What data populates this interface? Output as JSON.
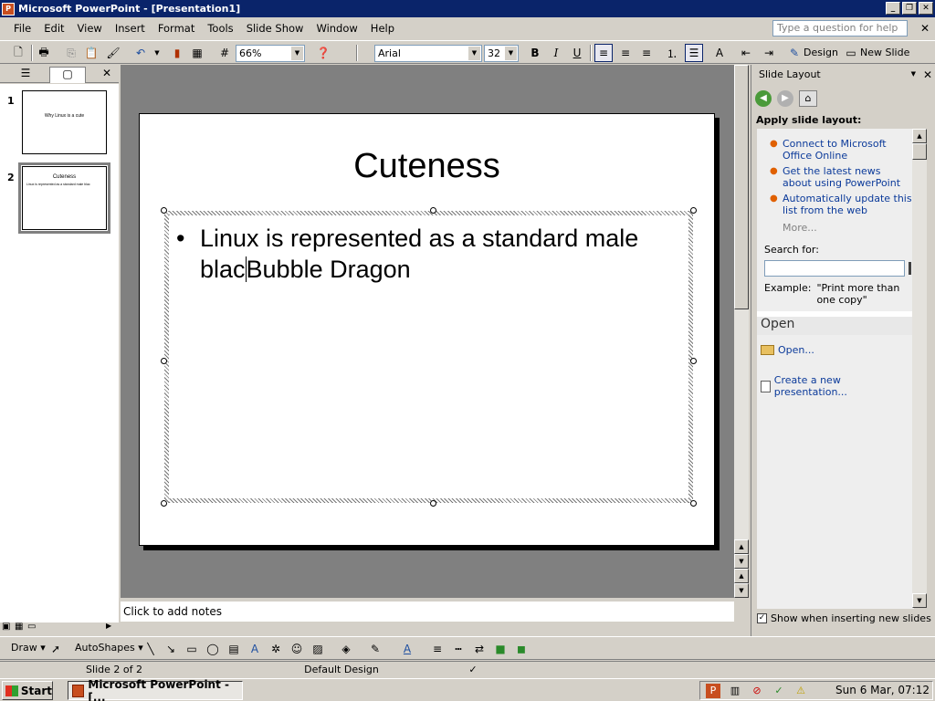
{
  "window": {
    "title": "Microsoft PowerPoint - [Presentation1]"
  },
  "menu": {
    "items": [
      "File",
      "Edit",
      "View",
      "Insert",
      "Format",
      "Tools",
      "Slide Show",
      "Window",
      "Help"
    ],
    "help_placeholder": "Type a question for help"
  },
  "toolbar": {
    "zoom": "66%",
    "font": "Arial",
    "font_size": "32",
    "bold": "B",
    "italic": "I",
    "underline": "U",
    "design_label": "Design",
    "new_slide_label": "New Slide"
  },
  "slides_pane": {
    "thumbs": [
      {
        "num": "1",
        "title": "Why Linux is a cute"
      },
      {
        "num": "2",
        "title": "Cuteness"
      }
    ]
  },
  "slide": {
    "title": "Cuteness",
    "bullet_before_caret": "Linux is represented as a standard male blac",
    "bullet_after_caret": "Bubble Dragon"
  },
  "notes": {
    "placeholder": "Click to add notes"
  },
  "task_pane": {
    "title": "Slide Layout",
    "apply_label": "Apply slide layout:",
    "links": [
      "Connect to Microsoft Office Online",
      "Get the latest news about using PowerPoint",
      "Automatically update this list from the web"
    ],
    "more": "More...",
    "search_label": "Search for:",
    "example_label": "Example:",
    "example_value": "\"Print more than one copy\"",
    "open_header": "Open",
    "open_link": "Open...",
    "create_link": "Create a new presentation...",
    "show_when_inserting": "Show when inserting new slides"
  },
  "draw_toolbar": {
    "draw": "Draw",
    "autoshapes": "AutoShapes"
  },
  "status": {
    "slide": "Slide 2 of 2",
    "design": "Default Design"
  },
  "taskbar": {
    "start": "Start",
    "app": "Microsoft PowerPoint - [...",
    "clock": "Sun  6 Mar, 07:12"
  }
}
